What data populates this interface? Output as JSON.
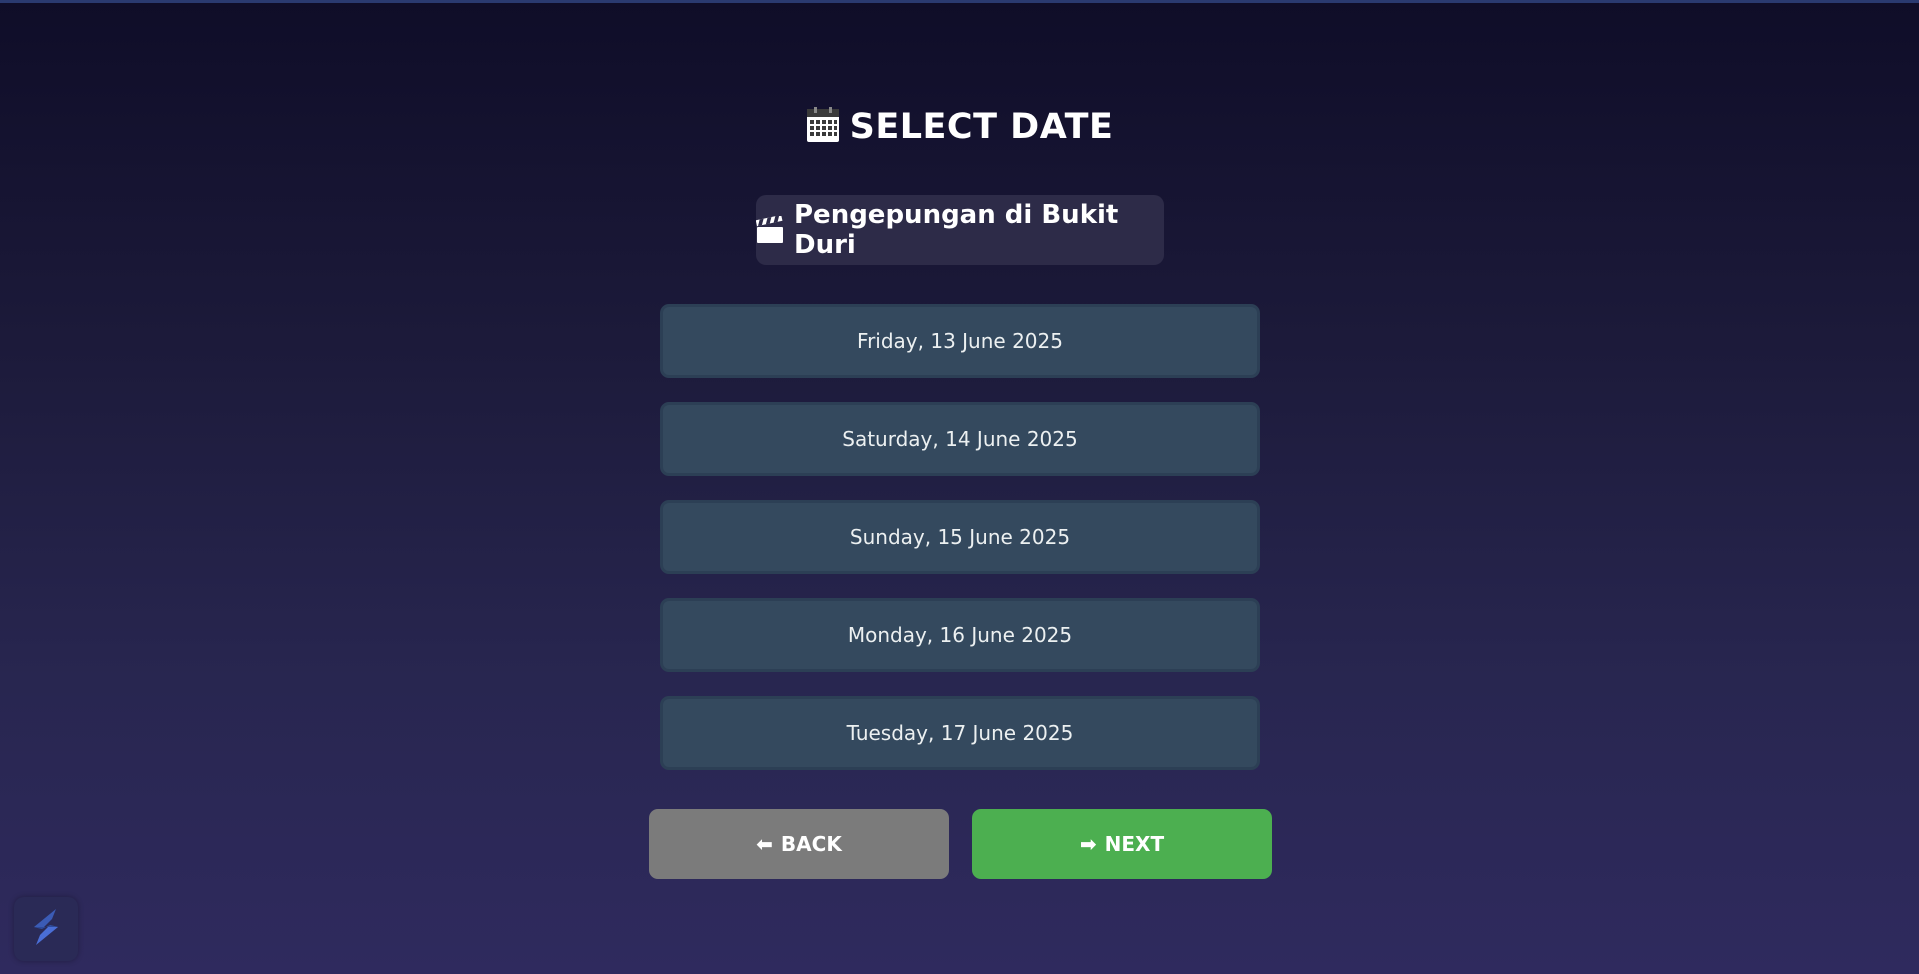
{
  "page": {
    "title": "SELECT DATE",
    "title_icon": "calendar-icon",
    "movie": {
      "title": "Pengepungan di Bukit Duri",
      "icon": "clapperboard-icon"
    }
  },
  "dates": [
    {
      "label": "Friday, 13 June 2025"
    },
    {
      "label": "Saturday, 14 June 2025"
    },
    {
      "label": "Sunday, 15 June 2025"
    },
    {
      "label": "Monday, 16 June 2025"
    },
    {
      "label": "Tuesday, 17 June 2025"
    }
  ],
  "nav": {
    "back": {
      "label": "BACK",
      "icon": "arrow-left-icon"
    },
    "next": {
      "label": "NEXT",
      "icon": "arrow-right-icon"
    }
  },
  "badge": {
    "icon": "app-logo-icon"
  },
  "colors": {
    "date_button": "#34495e",
    "back_button": "#7b7b7b",
    "next_button": "#4caf50",
    "movie_pill": "#2d2b48"
  }
}
